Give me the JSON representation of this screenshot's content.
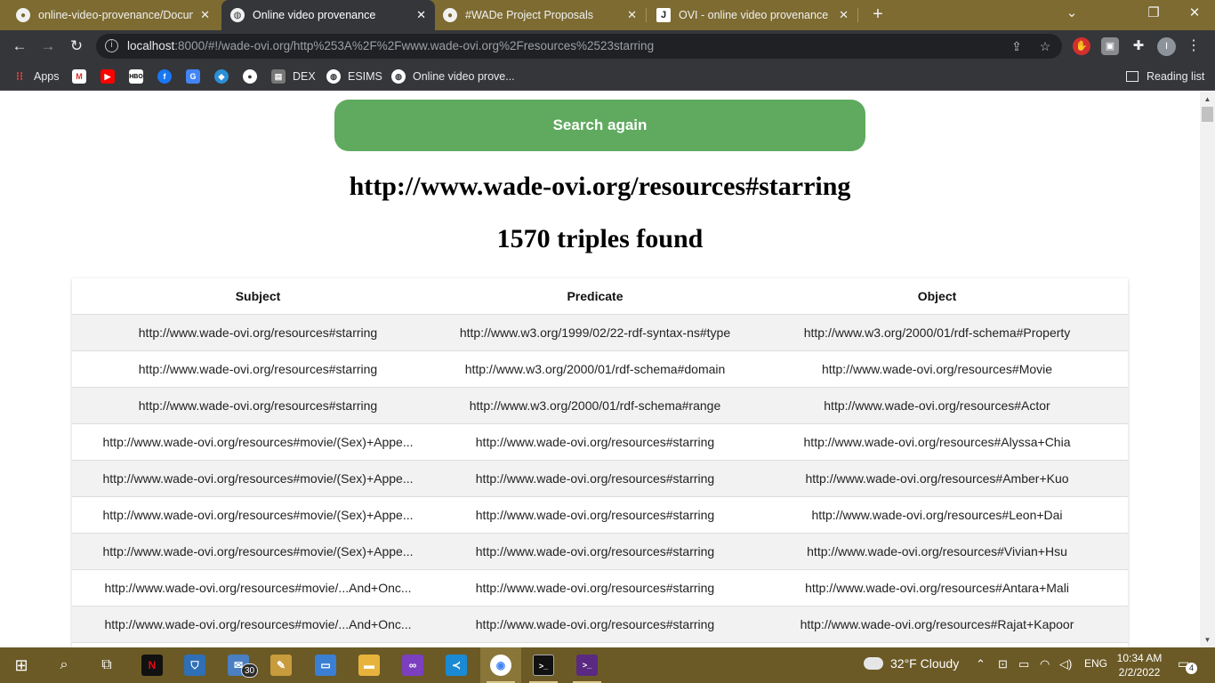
{
  "browser": {
    "tabs": [
      {
        "title": "online-video-provenance/Docum",
        "favicon": "github-icon"
      },
      {
        "title": "Online video provenance",
        "favicon": "globe-icon"
      },
      {
        "title": "#WADe Project Proposals",
        "favicon": "github-icon"
      },
      {
        "title": "OVI - online video provenance -",
        "favicon": "j-icon"
      }
    ],
    "close_glyph": "✕",
    "new_tab_glyph": "+",
    "window_controls": {
      "minimize": "⌄",
      "restore": "❐",
      "close": "✕"
    },
    "url": {
      "host": "localhost",
      "rest": ":8000/#!/wade-ovi.org/http%253A%2F%2Fwww.wade-ovi.org%2Fresources%2523starring"
    },
    "bookmarks": [
      "Apps",
      "DEX",
      "ESIMS",
      "Online video prove..."
    ],
    "reading_list": "Reading list",
    "profile_initial": "I"
  },
  "page": {
    "search_again": "Search again",
    "resource_uri": "http://www.wade-ovi.org/resources#starring",
    "triples_count": "1570 triples found",
    "columns": {
      "subject": "Subject",
      "predicate": "Predicate",
      "object": "Object"
    },
    "rows": [
      {
        "subject": "http://www.wade-ovi.org/resources#starring",
        "predicate": "http://www.w3.org/1999/02/22-rdf-syntax-ns#type",
        "object": "http://www.w3.org/2000/01/rdf-schema#Property"
      },
      {
        "subject": "http://www.wade-ovi.org/resources#starring",
        "predicate": "http://www.w3.org/2000/01/rdf-schema#domain",
        "object": "http://www.wade-ovi.org/resources#Movie"
      },
      {
        "subject": "http://www.wade-ovi.org/resources#starring",
        "predicate": "http://www.w3.org/2000/01/rdf-schema#range",
        "object": "http://www.wade-ovi.org/resources#Actor"
      },
      {
        "subject": "http://www.wade-ovi.org/resources#movie/(Sex)+Appe...",
        "predicate": "http://www.wade-ovi.org/resources#starring",
        "object": "http://www.wade-ovi.org/resources#Alyssa+Chia"
      },
      {
        "subject": "http://www.wade-ovi.org/resources#movie/(Sex)+Appe...",
        "predicate": "http://www.wade-ovi.org/resources#starring",
        "object": "http://www.wade-ovi.org/resources#Amber+Kuo"
      },
      {
        "subject": "http://www.wade-ovi.org/resources#movie/(Sex)+Appe...",
        "predicate": "http://www.wade-ovi.org/resources#starring",
        "object": "http://www.wade-ovi.org/resources#Leon+Dai"
      },
      {
        "subject": "http://www.wade-ovi.org/resources#movie/(Sex)+Appe...",
        "predicate": "http://www.wade-ovi.org/resources#starring",
        "object": "http://www.wade-ovi.org/resources#Vivian+Hsu"
      },
      {
        "subject": "http://www.wade-ovi.org/resources#movie/...And+Onc...",
        "predicate": "http://www.wade-ovi.org/resources#starring",
        "object": "http://www.wade-ovi.org/resources#Antara+Mali"
      },
      {
        "subject": "http://www.wade-ovi.org/resources#movie/...And+Onc...",
        "predicate": "http://www.wade-ovi.org/resources#starring",
        "object": "http://www.wade-ovi.org/resources#Rajat+Kapoor"
      },
      {
        "subject": "",
        "predicate": "",
        "object": ""
      }
    ]
  },
  "taskbar": {
    "mail_badge": "30",
    "weather": "32°F  Cloudy",
    "language": "ENG",
    "time": "10:34 AM",
    "date": "2/2/2022",
    "notifications": "4"
  },
  "colors": {
    "search_button": "#5faa5f",
    "tab_strip": "#7d6b31",
    "taskbar": "#6b5a26"
  }
}
